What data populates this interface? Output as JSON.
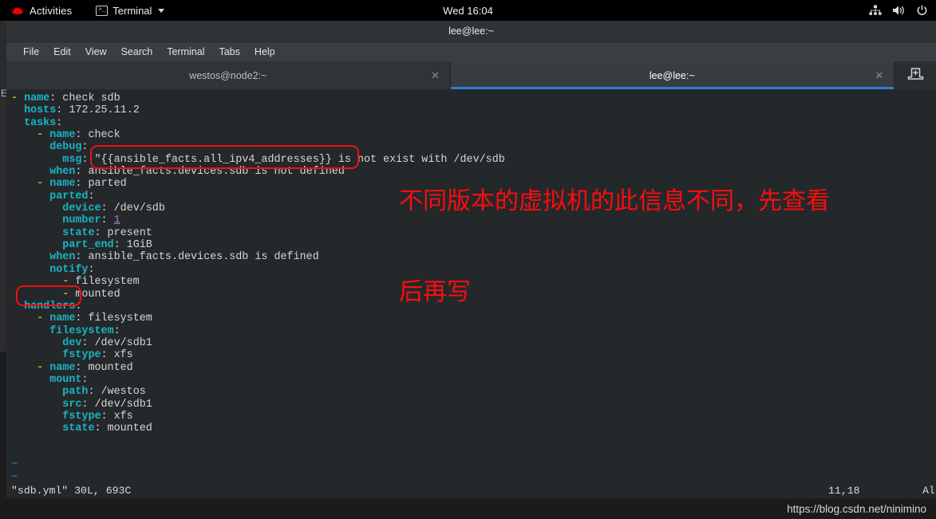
{
  "topbar": {
    "logo_icon": "redhat-logo-icon",
    "activities_label": "Activities",
    "app_icon": "terminal-icon",
    "app_label": "Terminal",
    "app_caret_icon": "chevron-down-icon",
    "clock": "Wed 16:04",
    "tray": [
      {
        "icon": "network-wired-icon"
      },
      {
        "icon": "volume-speaker-icon"
      },
      {
        "icon": "power-icon"
      }
    ]
  },
  "background_window": {
    "edge_letter": "E"
  },
  "window": {
    "title": "lee@lee:~",
    "menus": [
      "File",
      "Edit",
      "View",
      "Search",
      "Terminal",
      "Tabs",
      "Help"
    ],
    "tabs": [
      {
        "title": "westos@node2:~",
        "active": false,
        "close_icon": "close-icon"
      },
      {
        "title": "lee@lee:~",
        "active": true,
        "close_icon": "close-icon"
      }
    ],
    "new_tab_icon": "new-tab-icon"
  },
  "editor": {
    "lines": [
      [
        {
          "t": "- ",
          "c": "d"
        },
        {
          "t": "name",
          "c": "k"
        },
        {
          "t": ": check sdb",
          "c": "v"
        }
      ],
      [
        {
          "t": "  ",
          "c": "v"
        },
        {
          "t": "hosts",
          "c": "k"
        },
        {
          "t": ": 172.25.11.2",
          "c": "v"
        }
      ],
      [
        {
          "t": "  ",
          "c": "v"
        },
        {
          "t": "tasks",
          "c": "k"
        },
        {
          "t": ":",
          "c": "v"
        }
      ],
      [
        {
          "t": "    - ",
          "c": "d"
        },
        {
          "t": "name",
          "c": "k"
        },
        {
          "t": ": check",
          "c": "v"
        }
      ],
      [
        {
          "t": "      ",
          "c": "v"
        },
        {
          "t": "debug",
          "c": "k"
        },
        {
          "t": ":",
          "c": "v"
        }
      ],
      [
        {
          "t": "        ",
          "c": "v"
        },
        {
          "t": "msg",
          "c": "k"
        },
        {
          "t": ": \"{{ansible_facts.all_ipv4_addresses}} is not exist with /dev/sdb",
          "c": "v"
        }
      ],
      [
        {
          "t": "      ",
          "c": "v"
        },
        {
          "t": "when",
          "c": "k"
        },
        {
          "t": ": ansible_facts.devices.sdb is not defined",
          "c": "v"
        }
      ],
      [
        {
          "t": "    - ",
          "c": "d"
        },
        {
          "t": "name",
          "c": "k"
        },
        {
          "t": ": parted",
          "c": "v"
        }
      ],
      [
        {
          "t": "      ",
          "c": "v"
        },
        {
          "t": "parted",
          "c": "k"
        },
        {
          "t": ":",
          "c": "v"
        }
      ],
      [
        {
          "t": "        ",
          "c": "v"
        },
        {
          "t": "device",
          "c": "k"
        },
        {
          "t": ": /dev/sdb",
          "c": "v"
        }
      ],
      [
        {
          "t": "        ",
          "c": "v"
        },
        {
          "t": "number",
          "c": "k"
        },
        {
          "t": ": ",
          "c": "v"
        },
        {
          "t": "1",
          "c": "num"
        }
      ],
      [
        {
          "t": "        ",
          "c": "v"
        },
        {
          "t": "state",
          "c": "k"
        },
        {
          "t": ": present",
          "c": "v"
        }
      ],
      [
        {
          "t": "        ",
          "c": "v"
        },
        {
          "t": "part_end",
          "c": "k"
        },
        {
          "t": ": 1GiB",
          "c": "v"
        }
      ],
      [
        {
          "t": "      ",
          "c": "v"
        },
        {
          "t": "when",
          "c": "k"
        },
        {
          "t": ": ansible_facts.devices.sdb is defined",
          "c": "v"
        }
      ],
      [
        {
          "t": "      ",
          "c": "v"
        },
        {
          "t": "notify",
          "c": "k"
        },
        {
          "t": ":",
          "c": "v"
        }
      ],
      [
        {
          "t": "        - ",
          "c": "d"
        },
        {
          "t": "filesystem",
          "c": "v"
        }
      ],
      [
        {
          "t": "        - ",
          "c": "d"
        },
        {
          "t": "mounted",
          "c": "v"
        }
      ],
      [
        {
          "t": "  ",
          "c": "v"
        },
        {
          "t": "handlers",
          "c": "k"
        },
        {
          "t": ":",
          "c": "v"
        }
      ],
      [
        {
          "t": "    - ",
          "c": "d"
        },
        {
          "t": "name",
          "c": "k"
        },
        {
          "t": ": filesystem",
          "c": "v"
        }
      ],
      [
        {
          "t": "      ",
          "c": "v"
        },
        {
          "t": "filesystem",
          "c": "k"
        },
        {
          "t": ":",
          "c": "v"
        }
      ],
      [
        {
          "t": "        ",
          "c": "v"
        },
        {
          "t": "dev",
          "c": "k"
        },
        {
          "t": ": /dev/sdb1",
          "c": "v"
        }
      ],
      [
        {
          "t": "        ",
          "c": "v"
        },
        {
          "t": "fstype",
          "c": "k"
        },
        {
          "t": ": xfs",
          "c": "v"
        }
      ],
      [
        {
          "t": "    - ",
          "c": "d"
        },
        {
          "t": "name",
          "c": "k"
        },
        {
          "t": ": mounted",
          "c": "v"
        }
      ],
      [
        {
          "t": "      ",
          "c": "v"
        },
        {
          "t": "mount",
          "c": "k"
        },
        {
          "t": ":",
          "c": "v"
        }
      ],
      [
        {
          "t": "        ",
          "c": "v"
        },
        {
          "t": "path",
          "c": "k"
        },
        {
          "t": ": /westos",
          "c": "v"
        }
      ],
      [
        {
          "t": "        ",
          "c": "v"
        },
        {
          "t": "src",
          "c": "k"
        },
        {
          "t": ": /dev/sdb1",
          "c": "v"
        }
      ],
      [
        {
          "t": "        ",
          "c": "v"
        },
        {
          "t": "fstype",
          "c": "k"
        },
        {
          "t": ": xfs",
          "c": "v"
        }
      ],
      [
        {
          "t": "        ",
          "c": "v"
        },
        {
          "t": "state",
          "c": "k"
        },
        {
          "t": ": mounted",
          "c": "v"
        }
      ],
      [
        {
          "t": "",
          "c": "v"
        }
      ],
      [
        {
          "t": "",
          "c": "v"
        }
      ],
      [
        {
          "t": "~",
          "c": "tld"
        }
      ],
      [
        {
          "t": "~",
          "c": "tld"
        }
      ]
    ],
    "statusline": {
      "file_info": "\"sdb.yml\" 30L, 693C",
      "cursor_pos": "11,18",
      "scroll_pct": "Al"
    }
  },
  "annotations": {
    "msg_box_label": "msg-value-highlight-box",
    "handlers_box_label": "handlers-keyword-highlight-box",
    "note_line1": "不同版本的虚拟机的此信息不同，先查看",
    "note_line2": "后再写",
    "color": "#fb0d0d"
  },
  "watermark": {
    "url": "https://blog.csdn.net/ninimino"
  }
}
